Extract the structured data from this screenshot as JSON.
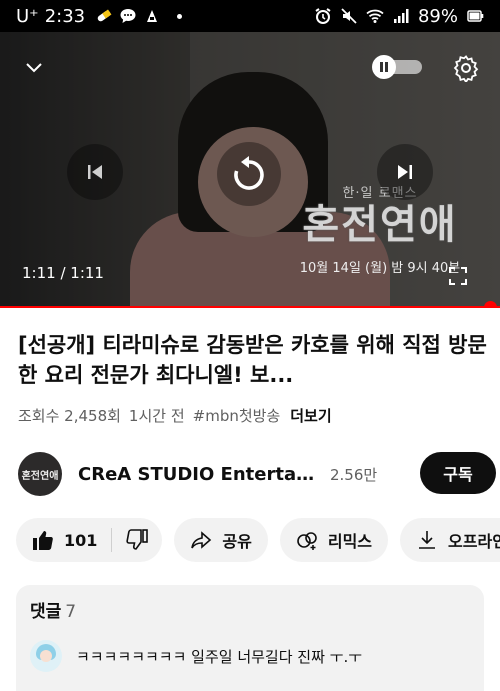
{
  "status_bar": {
    "carrier": "U⁺",
    "time": "2:33",
    "battery": "89%"
  },
  "player": {
    "time": "1:11 / 1:11",
    "progress": 1.0,
    "overlay_logo": {
      "subtitle": "한·일 로맨스",
      "name": "혼전연애",
      "airtime": "10월 14일 (월) 밤 9시 40분"
    },
    "icons": [
      "chevron-down-icon",
      "pause-toggle-icon",
      "settings-icon",
      "previous-icon",
      "replay-icon",
      "next-icon",
      "fullscreen-icon"
    ]
  },
  "video": {
    "title": "[선공개] 티라미슈로 감동받은 카호를 위해 직접 방문한 요리 전문가 최다니엘! 보...",
    "views": "조회수 2,458회",
    "age": "1시간 전",
    "hashtag": "#mbn첫방송",
    "more_label": "더보기"
  },
  "channel": {
    "avatar_text": "혼전연애",
    "name": "CReA STUDIO Entertain...",
    "subscribers": "2.56만",
    "subscribe_label": "구독"
  },
  "actions": {
    "like_count": "101",
    "share_label": "공유",
    "remix_label": "리믹스",
    "offline_label": "오프라인"
  },
  "comments": {
    "header": "댓글",
    "count": "7",
    "top_comment": "ㅋㅋㅋㅋㅋㅋㅋㅋ 일주일 너무길다 진짜 ㅜ.ㅜ"
  }
}
